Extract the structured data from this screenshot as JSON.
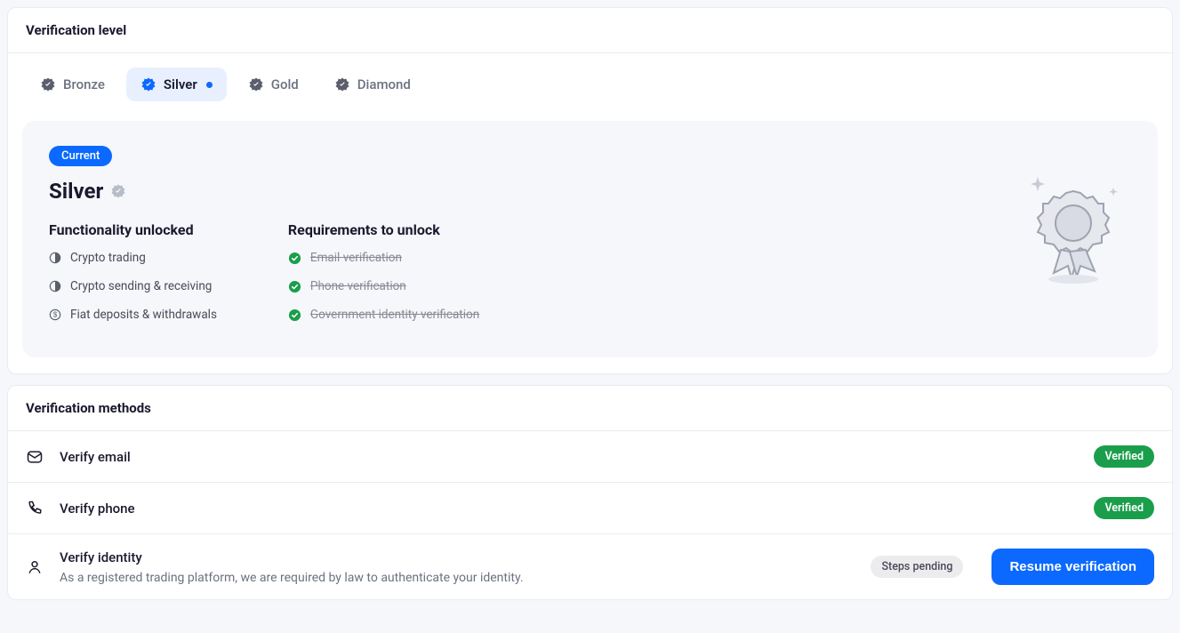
{
  "verification_level": {
    "title": "Verification level",
    "tabs": [
      {
        "label": "Bronze",
        "active": false
      },
      {
        "label": "Silver",
        "active": true
      },
      {
        "label": "Gold",
        "active": false
      },
      {
        "label": "Diamond",
        "active": false
      }
    ],
    "panel": {
      "chip": "Current",
      "level_name": "Silver",
      "functionality_title": "Functionality unlocked",
      "functionality": [
        "Crypto trading",
        "Crypto sending & receiving",
        "Fiat deposits & withdrawals"
      ],
      "requirements_title": "Requirements to unlock",
      "requirements": [
        {
          "label": "Email verification",
          "done": true
        },
        {
          "label": "Phone verification",
          "done": true
        },
        {
          "label": "Government identity verification",
          "done": true
        }
      ]
    }
  },
  "verification_methods": {
    "title": "Verification methods",
    "items": [
      {
        "title": "Verify email",
        "desc": "",
        "status": "Verified"
      },
      {
        "title": "Verify phone",
        "desc": "",
        "status": "Verified"
      },
      {
        "title": "Verify identity",
        "desc": "As a registered trading platform, we are required by law to authenticate your identity.",
        "status": "Steps pending",
        "action": "Resume verification"
      }
    ]
  },
  "colors": {
    "primary": "#0b69ff",
    "success": "#1a9e4b",
    "muted_bg": "#f5f7fa"
  }
}
